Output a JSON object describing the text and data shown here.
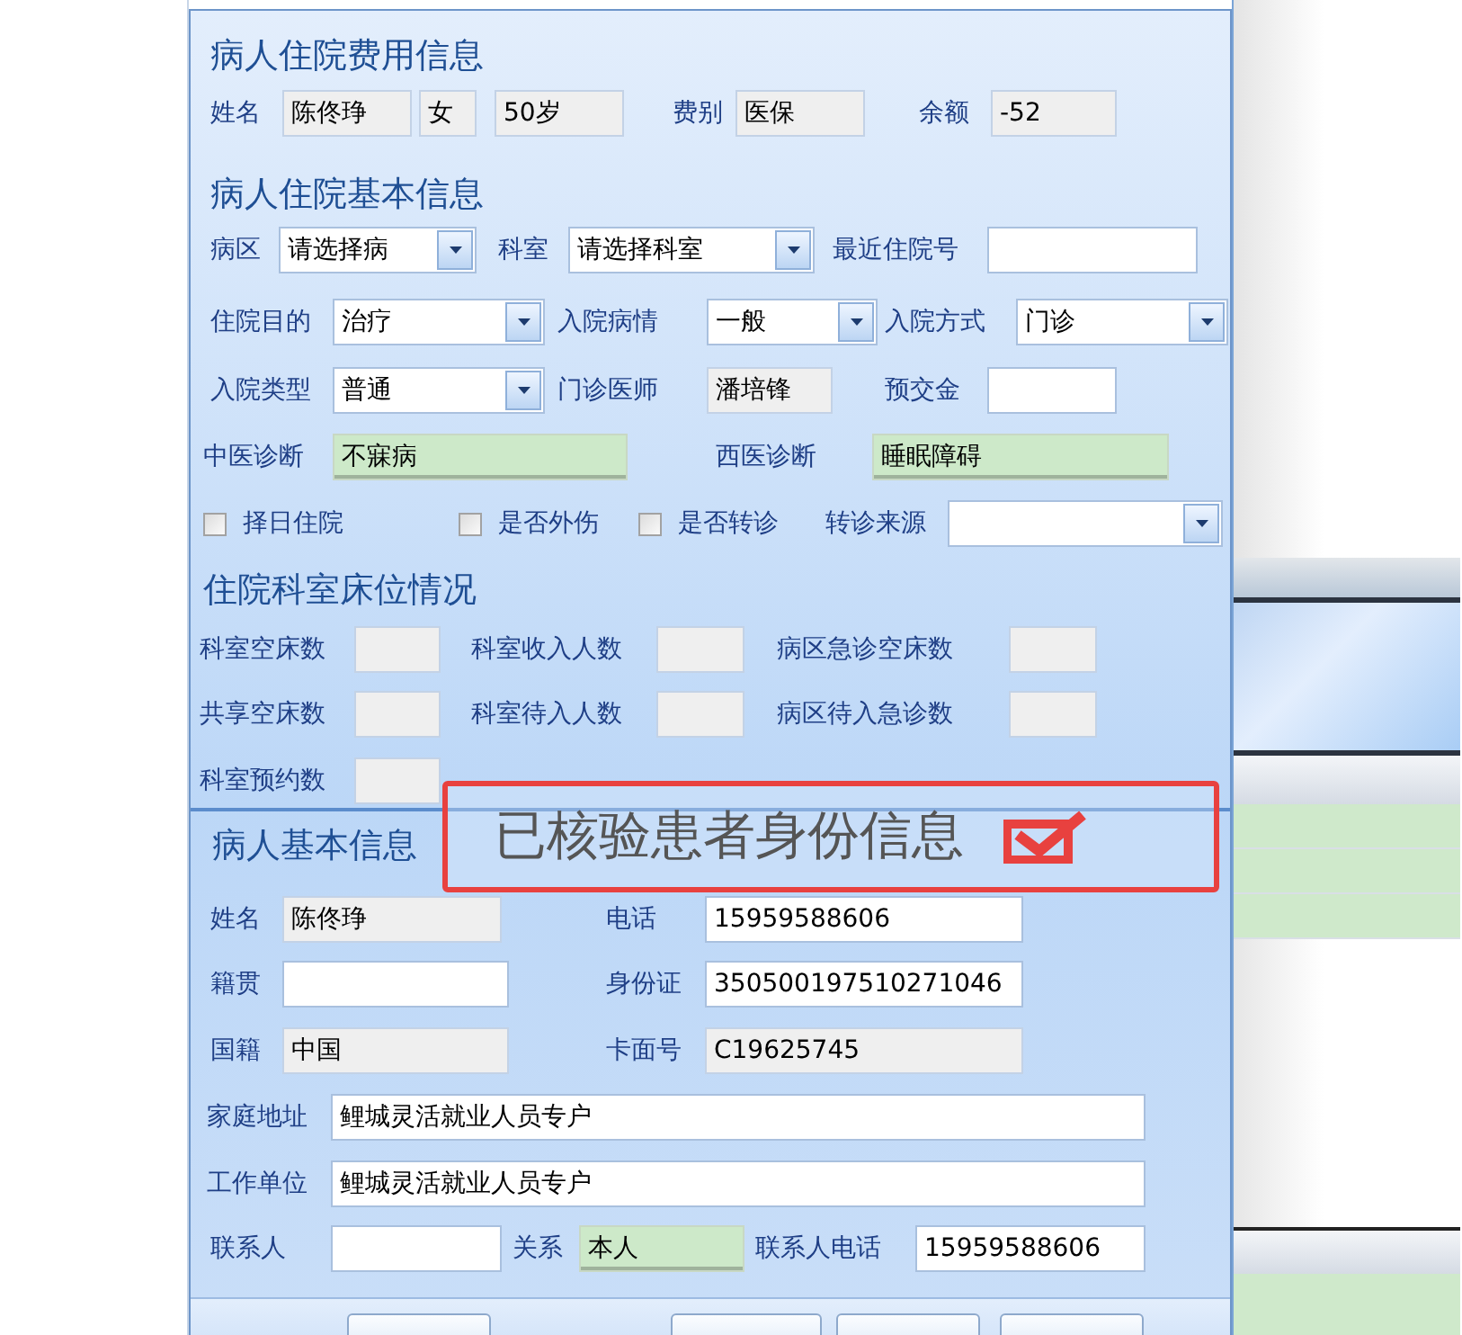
{
  "dialog": {
    "groups": [
      {
        "title": "病人住院费用信息",
        "rows": [
          [
            {
              "kind": "readonly",
              "label": "姓名",
              "value": "陈佟琤"
            },
            {
              "kind": "readonly",
              "value": "女"
            },
            {
              "kind": "readonly",
              "value": "50岁"
            },
            {
              "kind": "readonly",
              "label": "费别",
              "value": "医保"
            },
            {
              "kind": "readonly",
              "label": "余额",
              "value": "-52"
            }
          ]
        ]
      },
      {
        "title": "病人住院基本信息",
        "rows": [
          [
            {
              "kind": "combo",
              "label": "病区",
              "value": "请选择病"
            },
            {
              "kind": "combo",
              "label": "科室",
              "value": "请选择科室"
            },
            {
              "kind": "input",
              "label": "最近住院号"
            }
          ],
          [
            {
              "kind": "combo",
              "label": "住院目的",
              "value": "治疗"
            },
            {
              "kind": "combo",
              "label": "入院病情",
              "value": "一般"
            },
            {
              "kind": "combo",
              "label": "入院方式",
              "value": "门诊"
            }
          ],
          [
            {
              "kind": "combo",
              "label": "入院类型",
              "value": "普通"
            },
            {
              "kind": "readonly",
              "label": "门诊医师",
              "value": "潘培锋"
            },
            {
              "kind": "input",
              "label": "预交金"
            }
          ],
          [
            {
              "kind": "highlighted",
              "label": "中医诊断",
              "value": "不寐病"
            },
            {
              "kind": "highlighted",
              "label": "西医诊断",
              "value": "睡眠障碍"
            }
          ]
        ],
        "options": [
          {
            "kind": "checkbox",
            "label": "择日住院",
            "checked": false
          },
          {
            "kind": "checkbox",
            "label": "是否外伤",
            "checked": false
          },
          {
            "kind": "checkbox",
            "label": "是否转诊",
            "checked": false
          },
          {
            "kind": "combo",
            "label": "转诊来源"
          }
        ]
      },
      {
        "title": "住院科室床位情况",
        "rows": [
          [
            {
              "kind": "readonly",
              "label": "科室空床数"
            },
            {
              "kind": "readonly",
              "label": "科室收入人数"
            },
            {
              "kind": "readonly",
              "label": "病区急诊空床数"
            }
          ],
          [
            {
              "kind": "readonly",
              "label": "共享空床数"
            },
            {
              "kind": "readonly",
              "label": "科室待入人数"
            },
            {
              "kind": "readonly",
              "label": "病区待入急诊数"
            }
          ],
          [
            {
              "kind": "readonly",
              "label": "科室预约数"
            }
          ]
        ]
      },
      {
        "title": "病人基本信息",
        "rows": [
          [
            {
              "kind": "readonly",
              "label": "姓名",
              "value": "陈佟琤"
            },
            {
              "kind": "input",
              "label": "电话",
              "value": "15959588606"
            }
          ],
          [
            {
              "kind": "input",
              "label": "籍贯"
            },
            {
              "kind": "input",
              "label": "身份证",
              "value": "350500197510271046"
            }
          ],
          [
            {
              "kind": "readonly",
              "label": "国籍",
              "value": "中国"
            },
            {
              "kind": "readonly",
              "label": "卡面号",
              "value": "C19625745"
            }
          ],
          [
            {
              "kind": "input",
              "label": "家庭地址",
              "value": "鲤城灵活就业人员专户"
            }
          ],
          [
            {
              "kind": "input",
              "label": "工作单位",
              "value": "鲤城灵活就业人员专户"
            }
          ],
          [
            {
              "kind": "input",
              "label": "联系人"
            },
            {
              "kind": "highlighted",
              "label": "关系",
              "value": "本人"
            },
            {
              "kind": "input",
              "label": "联系人电话",
              "value": "15959588606"
            }
          ]
        ]
      }
    ],
    "buttons": [
      {
        "kind": "button"
      },
      {
        "kind": "button"
      },
      {
        "kind": "button"
      },
      {
        "kind": "button"
      }
    ]
  },
  "annotation": {
    "text": "已核验患者身份信息",
    "checked": true
  }
}
